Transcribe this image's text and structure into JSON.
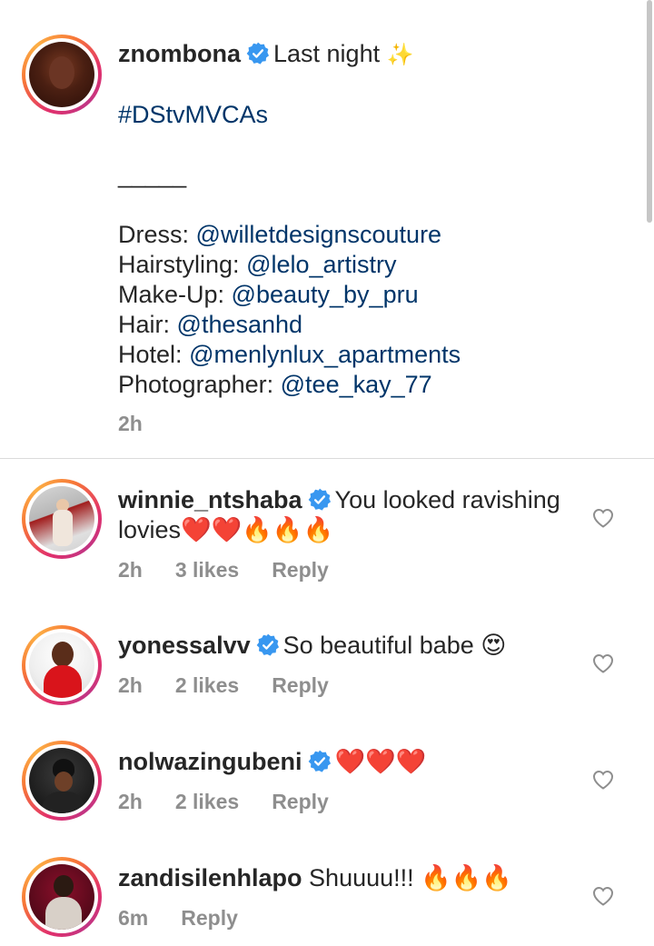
{
  "caption": {
    "username": "znombona",
    "text_first": "Last night",
    "hashtag": "#DStvMVCAs",
    "separator": "_____",
    "credits": [
      {
        "label": "Dress:",
        "handle": "@willetdesignscouture"
      },
      {
        "label": "Hairstyling:",
        "handle": "@lelo_artistry"
      },
      {
        "label": "Make-Up:",
        "handle": "@beauty_by_pru"
      },
      {
        "label": "Hair:",
        "handle": "@thesanhd"
      },
      {
        "label": "Hotel:",
        "handle": "@menlynlux_apartments"
      },
      {
        "label": "Photographer:",
        "handle": "@tee_kay_77"
      }
    ],
    "time": "2h",
    "sparkle": "✨"
  },
  "comments": [
    {
      "username": "winnie_ntshaba",
      "verified": true,
      "text": "You looked ravishing",
      "text2": "lovies❤️❤️🔥🔥🔥",
      "time": "2h",
      "likes": "3 likes",
      "reply": "Reply"
    },
    {
      "username": "yonessalvv",
      "verified": true,
      "text": "So beautiful babe 😍",
      "time": "2h",
      "likes": "2 likes",
      "reply": "Reply"
    },
    {
      "username": "nolwazingubeni",
      "verified": true,
      "text": "❤️❤️❤️",
      "time": "2h",
      "likes": "2 likes",
      "reply": "Reply"
    },
    {
      "username": "zandisilenhlapo",
      "verified": false,
      "text": "Shuuuu!!! 🔥🔥🔥",
      "time": "6m",
      "likes": "",
      "reply": "Reply"
    }
  ],
  "colors": {
    "link": "#003569",
    "verified": "#3897f0",
    "meta": "#8e8e8e"
  }
}
